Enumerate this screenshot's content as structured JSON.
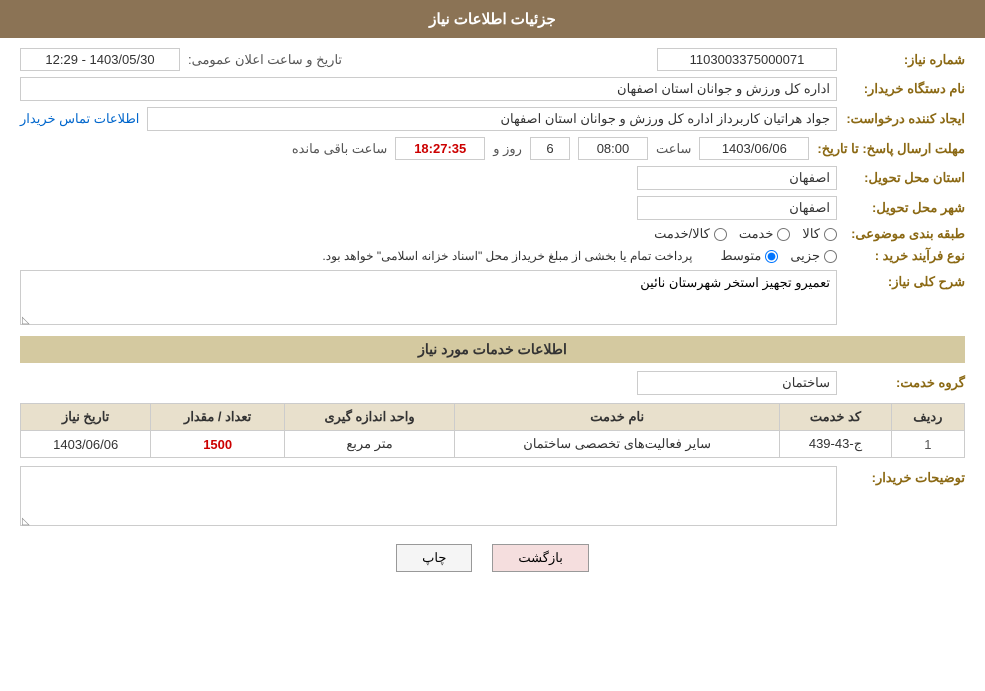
{
  "header": {
    "title": "جزئیات اطلاعات نیاز"
  },
  "fields": {
    "need_number_label": "شماره نیاز:",
    "need_number_value": "1103003375000071",
    "org_label": "نام دستگاه خریدار:",
    "org_value": "اداره کل ورزش و جوانان استان اصفهان",
    "announce_date_label": "تاریخ و ساعت اعلان عمومی:",
    "announce_date_value": "1403/05/30 - 12:29",
    "creator_label": "ایجاد کننده درخواست:",
    "creator_value": "جواد هراتیان کاربرداز اداره کل ورزش و جوانان استان اصفهان",
    "contact_link": "اطلاعات تماس خریدار",
    "deadline_label": "مهلت ارسال پاسخ: تا تاریخ:",
    "deadline_date": "1403/06/06",
    "deadline_time_label": "ساعت",
    "deadline_time_value": "08:00",
    "deadline_day_label": "روز و",
    "deadline_day_value": "6",
    "deadline_remaining_label": "ساعت باقی مانده",
    "deadline_remaining_value": "18:27:35",
    "province_label": "استان محل تحویل:",
    "province_value": "اصفهان",
    "city_label": "شهر محل تحویل:",
    "city_value": "اصفهان",
    "category_label": "طبقه بندی موضوعی:",
    "category_kala": "کالا",
    "category_khedmat": "خدمت",
    "category_kala_khedmat": "کالا/خدمت",
    "purchase_type_label": "نوع فرآیند خرید :",
    "purchase_jozi": "جزیی",
    "purchase_motavaset": "متوسط",
    "purchase_notice": "پرداخت تمام یا بخشی از مبلغ خریداز محل \"اسناد خزانه اسلامی\" خواهد بود.",
    "need_description_label": "شرح کلی نیاز:",
    "need_description_value": "تعمیرو تجهیز استخر شهرستان نائین",
    "services_section_label": "اطلاعات خدمات مورد نیاز",
    "service_group_label": "گروه خدمت:",
    "service_group_value": "ساختمان",
    "table_headers": {
      "row_num": "ردیف",
      "service_code": "کد خدمت",
      "service_name": "نام خدمت",
      "unit": "واحد اندازه گیری",
      "quantity": "تعداد / مقدار",
      "need_date": "تاریخ نیاز"
    },
    "table_rows": [
      {
        "row_num": "1",
        "service_code": "ج-43-439",
        "service_name": "سایر فعالیت‌های تخصصی ساختمان",
        "unit": "متر مربع",
        "quantity": "1500",
        "need_date": "1403/06/06"
      }
    ],
    "buyer_notes_label": "توضیحات خریدار:",
    "buyer_notes_value": ""
  },
  "buttons": {
    "print": "چاپ",
    "back": "بازگشت"
  }
}
